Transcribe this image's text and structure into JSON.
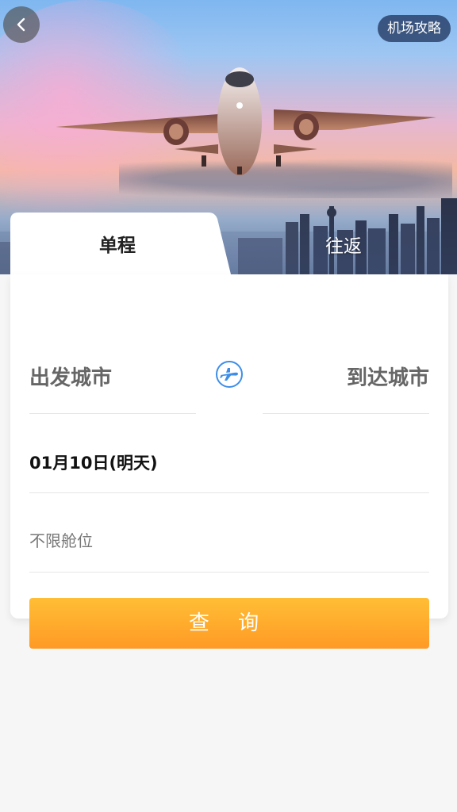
{
  "header": {
    "guide_label": "机场攻略",
    "back_icon": "chevron-left-icon"
  },
  "tabs": [
    {
      "label": "单程",
      "active": true
    },
    {
      "label": "往返",
      "active": false
    }
  ],
  "form": {
    "from_city": "出发城市",
    "to_city": "到达城市",
    "swap_icon": "plane-swap-icon",
    "date": "01月10日(明天)",
    "cabin": "不限舱位",
    "search_label": "查 询"
  },
  "colors": {
    "accent_start": "#ffbe35",
    "accent_end": "#ff9a25",
    "swap_icon": "#3d8ee8"
  }
}
